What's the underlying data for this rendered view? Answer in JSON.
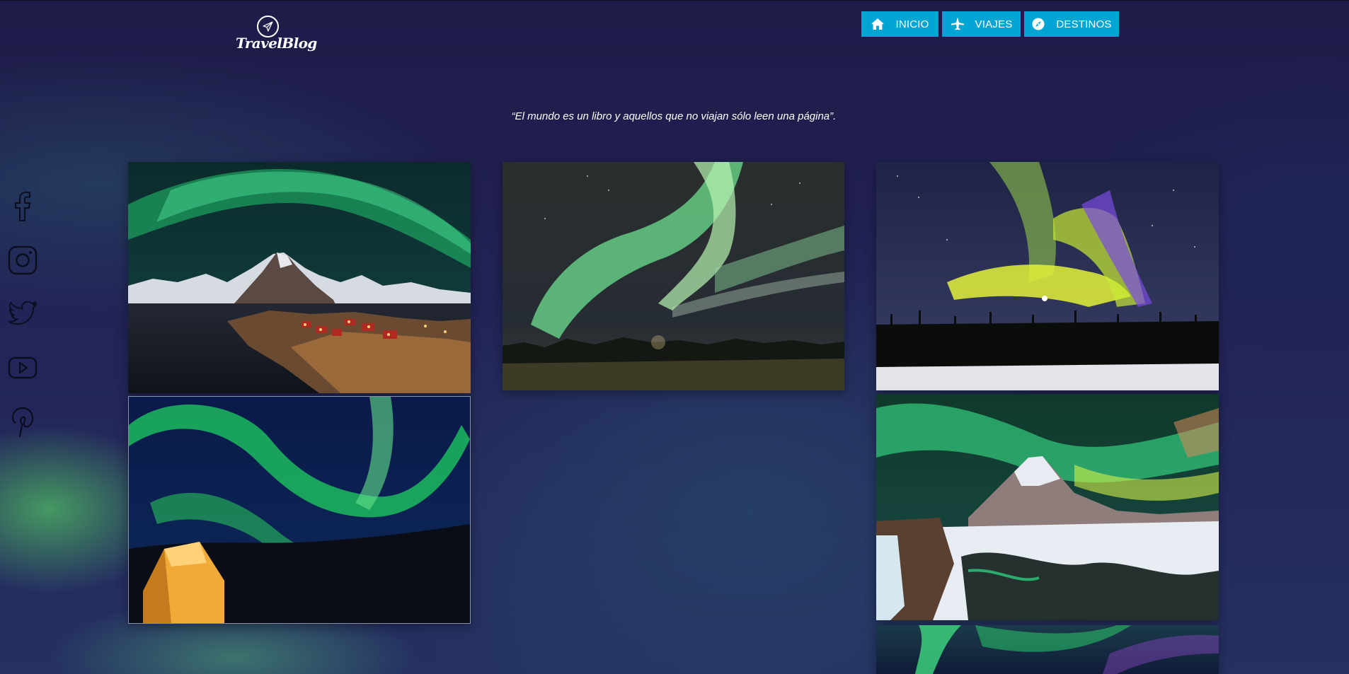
{
  "brand": {
    "name": "TravelBlog",
    "icon": "paper-plane-icon"
  },
  "nav": {
    "items": [
      {
        "label": "INICIO",
        "icon": "home-icon"
      },
      {
        "label": "VIAJES",
        "icon": "airplane-icon"
      },
      {
        "label": "DESTINOS",
        "icon": "compass-icon"
      }
    ],
    "button_color": "#00a5d3"
  },
  "quote": "“El mundo es un libro y aquellos que no viajan sólo leen una página”.",
  "social": [
    {
      "icon": "facebook-icon"
    },
    {
      "icon": "instagram-icon"
    },
    {
      "icon": "twitter-icon"
    },
    {
      "icon": "youtube-icon"
    },
    {
      "icon": "pinterest-icon"
    }
  ],
  "gallery": [
    {
      "subject": "aurora-over-fishing-village-photo"
    },
    {
      "subject": "aurora-over-treeline-photo"
    },
    {
      "subject": "yellow-green-aurora-over-snowy-forest-photo"
    },
    {
      "subject": "aurora-over-lit-tent-photo"
    },
    {
      "subject": "aurora-over-snowy-mountain-photo"
    },
    {
      "subject": "aurora-photo-partially-visible"
    }
  ],
  "colors": {
    "background": "#232458",
    "text": "#ffffff"
  }
}
